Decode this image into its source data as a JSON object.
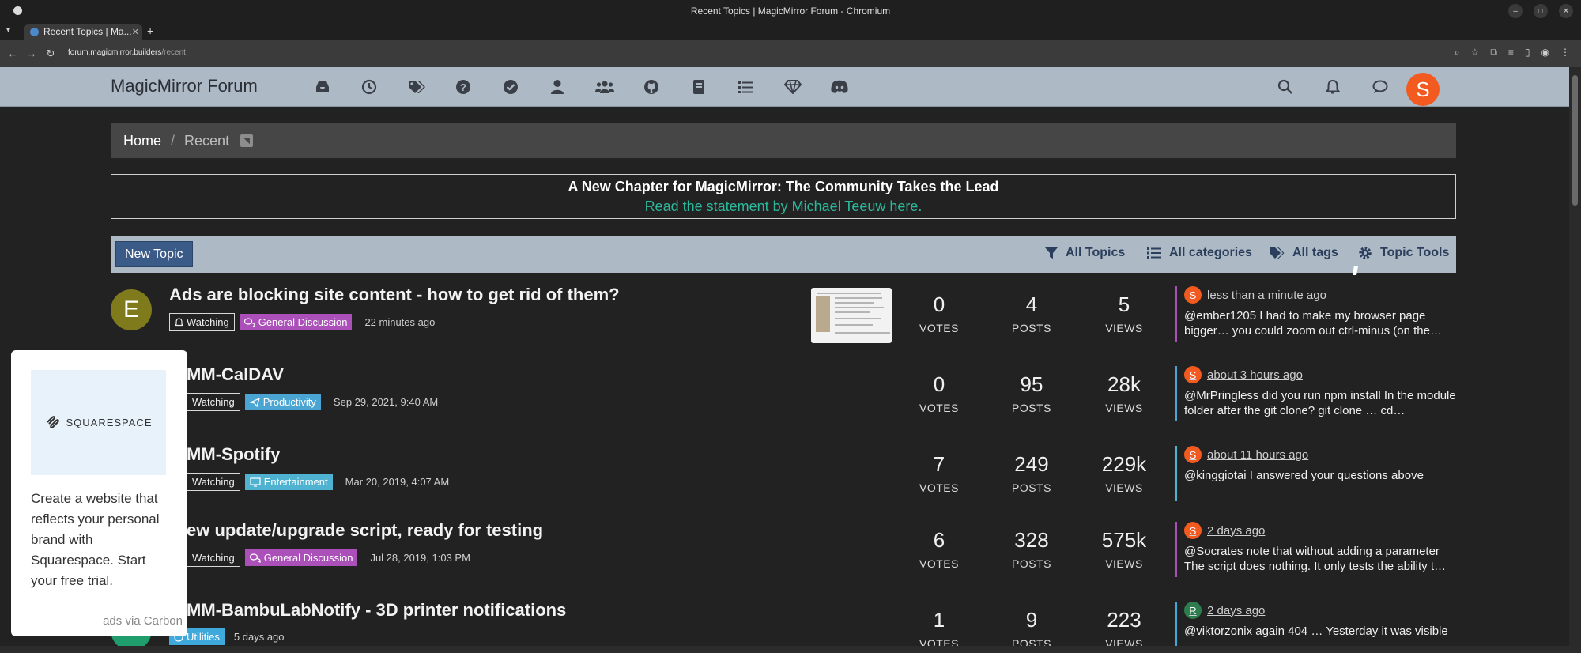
{
  "window": {
    "title": "Recent Topics | MagicMirror Forum - Chromium"
  },
  "tab": {
    "label": "Recent Topics | Ma..."
  },
  "address": {
    "domain": "forum.magicmirror.builders",
    "path": "/recent"
  },
  "header": {
    "brand": "MagicMirror Forum",
    "user_initial": "S"
  },
  "breadcrumb": {
    "home": "Home",
    "sep": "/",
    "current": "Recent"
  },
  "announcement": {
    "title": "A New Chapter for MagicMirror: The Community Takes the Lead",
    "link": "Read the statement by Michael Teeuw here."
  },
  "toolbar": {
    "new_topic": "New Topic",
    "all_topics": "All Topics",
    "all_categories": "All categories",
    "all_tags": "All tags",
    "topic_tools": "Topic Tools"
  },
  "stat_labels": {
    "votes": "VOTES",
    "posts": "POSTS",
    "views": "VIEWS"
  },
  "topics": [
    {
      "avatar": "E",
      "title": "Ads are blocking site content - how to get rid of them?",
      "watch": "Watching",
      "category": "General Discussion",
      "time": "22 minutes ago",
      "votes": "0",
      "posts": "4",
      "views": "5",
      "teaser_initial": "S",
      "teaser_time": "less than a minute ago",
      "teaser_text": "@ember1205 I had to make my browser page bigger… you could zoom out ctrl-minus (on the…"
    },
    {
      "title": "MM-CalDAV",
      "watch": "Watching",
      "category": "Productivity",
      "time": "Sep 29, 2021, 9:40 AM",
      "votes": "0",
      "posts": "95",
      "views": "28k",
      "teaser_initial": "S",
      "teaser_time": "about 3 hours ago",
      "teaser_text": "@MrPringless did you run npm install In the module folder after the git clone? git clone … cd…"
    },
    {
      "title": "MM-Spotify",
      "watch": "Watching",
      "category": "Entertainment",
      "time": "Mar 20, 2019, 4:07 AM",
      "votes": "7",
      "posts": "249",
      "views": "229k",
      "teaser_initial": "S",
      "teaser_time": "about 11 hours ago",
      "teaser_text": "@kinggiotai I answered your questions above"
    },
    {
      "title": "ew update/upgrade script, ready for testing",
      "watch": "Watching",
      "category": "General Discussion",
      "time": "Jul 28, 2019, 1:03 PM",
      "votes": "6",
      "posts": "328",
      "views": "575k",
      "teaser_initial": "S",
      "teaser_time": "2 days ago",
      "teaser_text": "@Socrates note that without adding a parameter The script does nothing. It only tests the ability t…"
    },
    {
      "title": "MM-BambuLabNotify - 3D printer notifications",
      "category": "Utilities",
      "time": "5 days ago",
      "votes": "1",
      "posts": "9",
      "views": "223",
      "teaser_initial": "R",
      "teaser_time": "2 days ago",
      "teaser_text": "@viktorzonix again 404 … Yesterday it was visible"
    }
  ],
  "ad": {
    "brand": "SQUARESPACE",
    "text": "Create a website that reflects your personal brand with Squarespace. Start your free trial.",
    "via": "ads via Carbon"
  },
  "colors": {
    "header_bg": "#aeb9c6",
    "general_discussion": "#ab4fb9",
    "productivity": "#4aa5d3",
    "entertainment": "#4fb2d0",
    "utilities": "#3fa9dc",
    "avatar_orange": "#f25a1f",
    "link_teal": "#2cb89b"
  }
}
